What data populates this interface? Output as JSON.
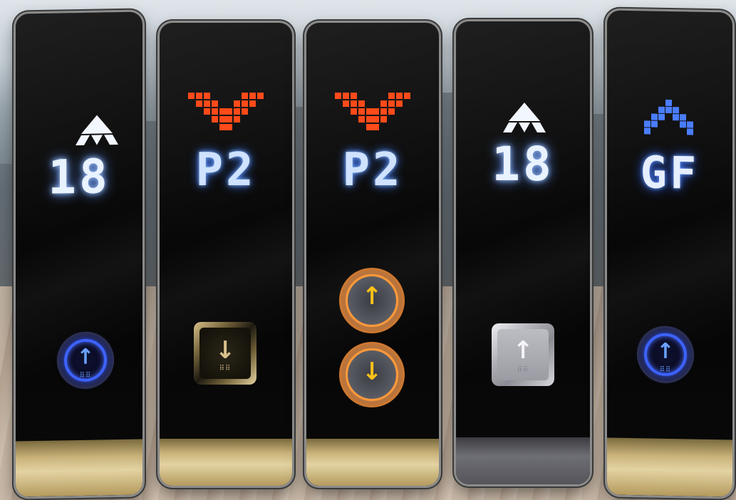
{
  "panels": [
    {
      "floor": "18",
      "direction": "up",
      "button": "round-blue"
    },
    {
      "floor": "P2",
      "direction": "down",
      "button": "square-gold"
    },
    {
      "floor": "P2",
      "direction": "down",
      "button": "round-gold-pair"
    },
    {
      "floor": "18",
      "direction": "up",
      "button": "square-steel"
    },
    {
      "floor": "GF",
      "direction": "up",
      "button": "round-blue"
    }
  ],
  "colors": {
    "blue_glow": "#5b8fff",
    "orange_arrow": "#ff4a1a",
    "gold_trim": "#c9b27a",
    "steel_trim": "#6e6e75"
  },
  "icons": {
    "up_arrow": "↑",
    "down_arrow": "↓",
    "braille": "⠿⠿"
  }
}
